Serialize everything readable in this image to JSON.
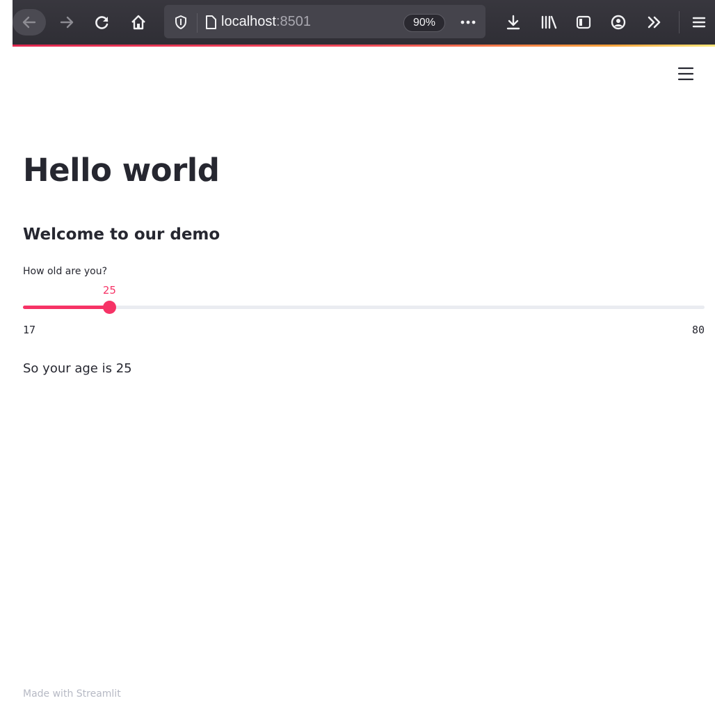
{
  "browser": {
    "url_host": "localhost",
    "url_port": ":8501",
    "zoom_level": "90%",
    "icons": [
      "back-icon",
      "forward-icon",
      "reload-icon",
      "home-icon",
      "shield-icon",
      "page-icon",
      "more-icon",
      "download-icon",
      "library-icon",
      "sidebar-icon",
      "account-icon",
      "overflow-icon",
      "menu-icon"
    ]
  },
  "app": {
    "menu_icon": "hamburger-icon",
    "title": "Hello world",
    "subheader": "Welcome to our demo",
    "slider": {
      "label": "How old are you?",
      "min": 17,
      "max": 80,
      "value": 25,
      "min_label": "17",
      "max_label": "80",
      "value_label": "25",
      "accent_color": "#f63366"
    },
    "result_text": "So your age is 25",
    "footer_text": "Made with Streamlit"
  }
}
